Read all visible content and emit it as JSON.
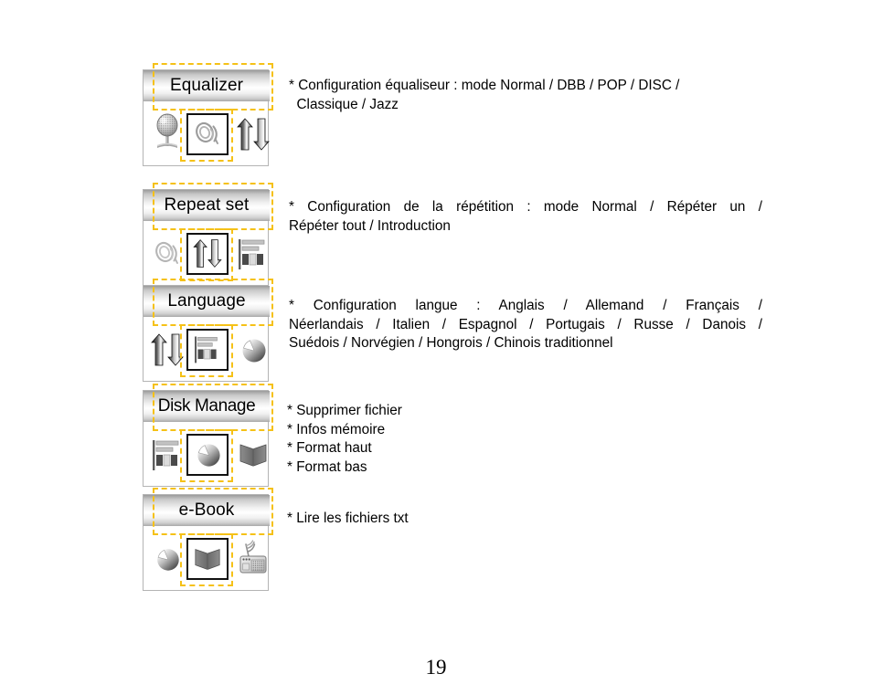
{
  "page": {
    "number": "19"
  },
  "menus": [
    {
      "id": "equalizer",
      "title": "Equalizer",
      "icons": {
        "left": "microphone-icon",
        "center": "sound-waves-icon",
        "right": "up-down-arrows-icon"
      },
      "description_lines": [
        "* Configuration équaliseur : mode Normal / DBB / POP / DISC /",
        "  Classique / Jazz"
      ],
      "description": "* Configuration équaliseur : mode Normal / DBB / POP / DISC / Classique / Jazz"
    },
    {
      "id": "repeat-set",
      "title": "Repeat set",
      "icons": {
        "left": "sound-waves-icon",
        "center": "up-down-arrows-icon",
        "right": "bar-chart-icon"
      },
      "description_lines": [
        "* Configuration de la répétition : mode Normal / Répéter un /",
        "Répéter tout / Introduction"
      ],
      "description": "* Configuration de la répétition : mode Normal / Répéter un / Répéter tout / Introduction"
    },
    {
      "id": "language",
      "title": "Language",
      "icons": {
        "left": "up-down-arrows-icon",
        "center": "bar-chart-icon",
        "right": "pie-chart-icon"
      },
      "description_lines": [
        "* Configuration langue : Anglais / Allemand / Français /",
        "Néerlandais / Italien / Espagnol / Portugais / Russe / Danois /",
        "Suédois / Norvégien / Hongrois / Chinois traditionnel"
      ],
      "description": "* Configuration langue : Anglais / Allemand / Français / Néerlandais / Italien / Espagnol / Portugais / Russe / Danois / Suédois / Norvégien / Hongrois / Chinois traditionnel"
    },
    {
      "id": "disk-manage",
      "title": "Disk Manage",
      "icons": {
        "left": "bar-chart-icon",
        "center": "pie-chart-icon",
        "right": "book-icon"
      },
      "description_lines": [
        "* Supprimer fichier",
        "* Infos mémoire",
        "* Format haut",
        "* Format bas"
      ],
      "description": "* Supprimer fichier / * Infos mémoire / * Format haut / * Format bas"
    },
    {
      "id": "e-book",
      "title": "e-Book",
      "icons": {
        "left": "pie-chart-icon",
        "center": "book-icon",
        "right": "radio-icon"
      },
      "description_lines": [
        "* Lire les fichiers txt"
      ],
      "description": "* Lire les fichiers txt"
    }
  ],
  "colors": {
    "highlight_dashed": "#f5c117",
    "panel_border": "#b4b4b4",
    "icon_box_border": "#111111",
    "text": "#000000"
  }
}
